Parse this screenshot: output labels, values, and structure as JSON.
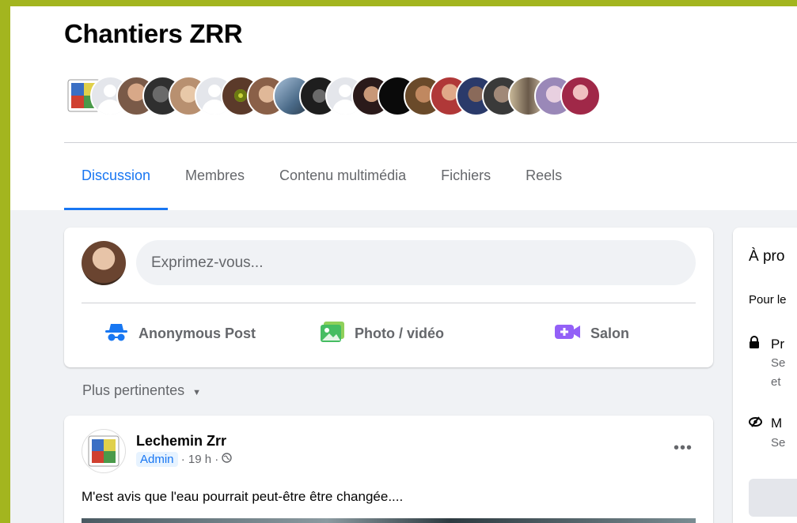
{
  "group": {
    "title": "Chantiers ZRR",
    "member_avatar_colors": [
      "#c9492f",
      "#e4e6eb",
      "#7a5a48",
      "#3b3b3b",
      "#c9a07a",
      "#e4e6eb",
      "#5b3a2a",
      "#b57a5a",
      "#6c8ca6",
      "#2a2a2a",
      "#e4e6eb",
      "#3a2a2a",
      "#0a0a0a",
      "#8a5a3a",
      "#c05040",
      "#4a5a7a",
      "#555555",
      "#9a8a6a",
      "#b0a0c0",
      "#a03050"
    ]
  },
  "tabs": [
    "Discussion",
    "Membres",
    "Contenu multimédia",
    "Fichiers",
    "Reels"
  ],
  "composer": {
    "placeholder": "Exprimez-vous...",
    "actions": {
      "anonymous": "Anonymous Post",
      "photo": "Photo / vidéo",
      "room": "Salon"
    }
  },
  "feed": {
    "sort_label": "Plus pertinentes"
  },
  "post": {
    "author": "Lechemin Zrr",
    "role": "Admin",
    "time": "19 h",
    "text": "M'est avis que l'eau pourrait peut-être être changée...."
  },
  "about": {
    "title": "À pro",
    "desc": "Pour le",
    "row1_title": "Pr",
    "row1_sub1": "Se",
    "row1_sub2": "et",
    "row2_title": "M",
    "row2_sub": "Se"
  },
  "colors": {
    "accent": "#1876f2",
    "outer_border": "#a3b51f"
  }
}
